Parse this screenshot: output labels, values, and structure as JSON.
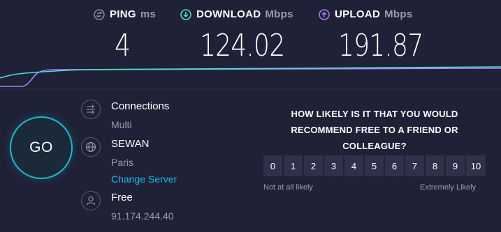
{
  "stats": {
    "ping": {
      "label": "PING",
      "unit": "ms",
      "value": "4",
      "icon": "ping-icon"
    },
    "download": {
      "label": "DOWNLOAD",
      "unit": "Mbps",
      "value": "124.02",
      "icon": "download-arrow-icon",
      "color": "#4ee0d0"
    },
    "upload": {
      "label": "UPLOAD",
      "unit": "Mbps",
      "value": "191.87",
      "icon": "upload-arrow-icon",
      "color": "#b07cf5"
    }
  },
  "go_button": {
    "label": "GO",
    "color": "#1fb8c8"
  },
  "connections": {
    "title": "Connections",
    "value": "Multi",
    "icon": "connections-icon"
  },
  "server": {
    "title": "SEWAN",
    "location": "Paris",
    "change_label": "Change Server",
    "icon": "globe-icon"
  },
  "provider": {
    "title": "Free",
    "ip": "91.174.244.40",
    "icon": "user-icon"
  },
  "survey": {
    "question": "HOW LIKELY IS IT THAT YOU WOULD RECOMMEND FREE TO A FRIEND OR COLLEAGUE?",
    "scale": [
      "0",
      "1",
      "2",
      "3",
      "4",
      "5",
      "6",
      "7",
      "8",
      "9",
      "10"
    ],
    "low_label": "Not at all likely",
    "high_label": "Extremely Likely"
  },
  "colors": {
    "background": "#1f2137",
    "accent": "#1fb8e8",
    "muted": "#9a9cb1"
  }
}
